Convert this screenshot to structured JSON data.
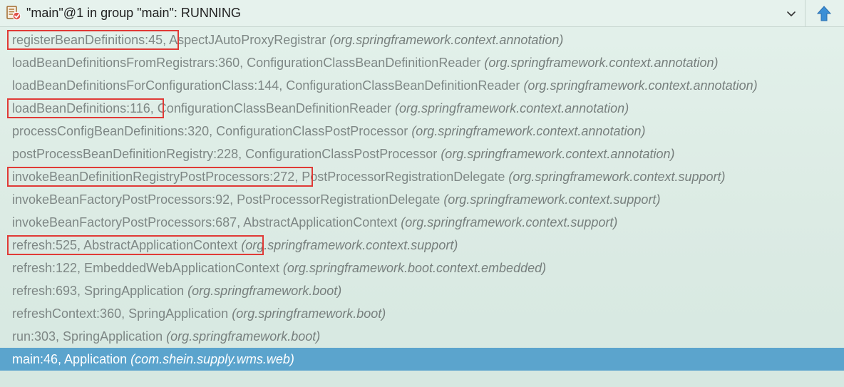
{
  "header": {
    "thread_label": "\"main\"@1 in group \"main\": RUNNING",
    "icons": {
      "thread": "thread-status-icon",
      "dropdown": "chevron-down-icon",
      "up": "arrow-up-icon"
    }
  },
  "colors": {
    "background": "#dfeee7",
    "text": "#7e8785",
    "selected_background": "#5ba4cd",
    "selected_text": "#ffffff",
    "highlight_box": "#e03a36",
    "up_arrow": "#3b8fd6"
  },
  "frames": [
    {
      "method": "registerBeanDefinitions:45, AspectJAutoProxyRegistrar",
      "package": "(org.springframework.context.annotation)",
      "highlighted": true
    },
    {
      "method": "loadBeanDefinitionsFromRegistrars:360, ConfigurationClassBeanDefinitionReader",
      "package": "(org.springframework.context.annotation)",
      "highlighted": false
    },
    {
      "method": "loadBeanDefinitionsForConfigurationClass:144, ConfigurationClassBeanDefinitionReader",
      "package": "(org.springframework.context.annotation)",
      "highlighted": false
    },
    {
      "method": "loadBeanDefinitions:116, ConfigurationClassBeanDefinitionReader",
      "package": "(org.springframework.context.annotation)",
      "highlighted": true
    },
    {
      "method": "processConfigBeanDefinitions:320, ConfigurationClassPostProcessor",
      "package": "(org.springframework.context.annotation)",
      "highlighted": false
    },
    {
      "method": "postProcessBeanDefinitionRegistry:228, ConfigurationClassPostProcessor",
      "package": "(org.springframework.context.annotation)",
      "highlighted": false
    },
    {
      "method": "invokeBeanDefinitionRegistryPostProcessors:272, PostProcessorRegistrationDelegate",
      "package": "(org.springframework.context.support)",
      "highlighted": true
    },
    {
      "method": "invokeBeanFactoryPostProcessors:92, PostProcessorRegistrationDelegate",
      "package": "(org.springframework.context.support)",
      "highlighted": false
    },
    {
      "method": "invokeBeanFactoryPostProcessors:687, AbstractApplicationContext",
      "package": "(org.springframework.context.support)",
      "highlighted": false
    },
    {
      "method": "refresh:525, AbstractApplicationContext",
      "package": "(org.springframework.context.support)",
      "highlighted": true
    },
    {
      "method": "refresh:122, EmbeddedWebApplicationContext",
      "package": "(org.springframework.boot.context.embedded)",
      "highlighted": false
    },
    {
      "method": "refresh:693, SpringApplication",
      "package": "(org.springframework.boot)",
      "highlighted": false
    },
    {
      "method": "refreshContext:360, SpringApplication",
      "package": "(org.springframework.boot)",
      "highlighted": false
    },
    {
      "method": "run:303, SpringApplication",
      "package": "(org.springframework.boot)",
      "highlighted": false
    },
    {
      "method": "main:46, Application",
      "package": "(com.shein.supply.wms.web)",
      "highlighted": false,
      "selected": true
    }
  ]
}
